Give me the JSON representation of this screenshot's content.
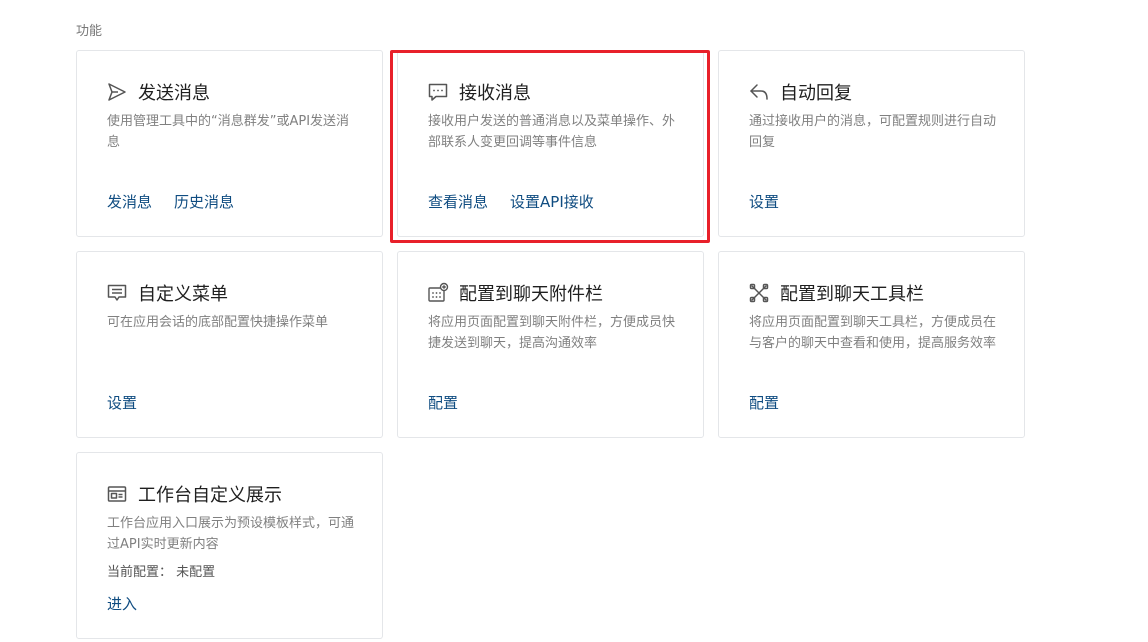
{
  "section": {
    "title": "功能"
  },
  "cards": [
    {
      "title": "发送消息",
      "icon": "send-icon",
      "desc": "使用管理工具中的“消息群发”或API发送消息",
      "links": [
        "发消息",
        "历史消息"
      ]
    },
    {
      "title": "接收消息",
      "icon": "message-bubble-icon",
      "desc": "接收用户发送的普通消息以及菜单操作、外部联系人变更回调等事件信息",
      "links": [
        "查看消息",
        "设置API接收"
      ]
    },
    {
      "title": "自动回复",
      "icon": "reply-icon",
      "desc": "通过接收用户的消息，可配置规则进行自动回复",
      "links": [
        "设置"
      ]
    },
    {
      "title": "自定义菜单",
      "icon": "menu-icon",
      "desc": "可在应用会话的底部配置快捷操作菜单",
      "links": [
        "设置"
      ]
    },
    {
      "title": "配置到聊天附件栏",
      "icon": "attachment-bar-icon",
      "desc": "将应用页面配置到聊天附件栏，方便成员快捷发送到聊天，提高沟通效率",
      "links": [
        "配置"
      ]
    },
    {
      "title": "配置到聊天工具栏",
      "icon": "toolbar-icon",
      "desc": "将应用页面配置到聊天工具栏，方便成员在与客户的聊天中查看和使用，提高服务效率",
      "links": [
        "配置"
      ]
    },
    {
      "title": "工作台自定义展示",
      "icon": "workbench-icon",
      "desc": "工作台应用入口展示为预设模板样式，可通过API实时更新内容",
      "meta": "当前配置： 未配置",
      "links": [
        "进入"
      ]
    }
  ],
  "highlight_color": "#e8202a",
  "link_color": "#0f4c81"
}
